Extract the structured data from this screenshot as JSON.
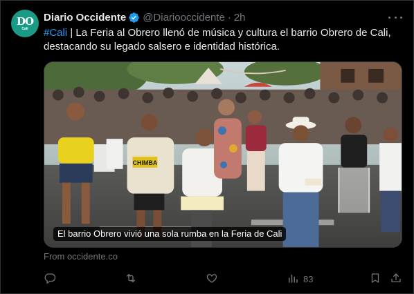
{
  "account": {
    "avatar_monogram": "DO",
    "avatar_subtext": "Cali",
    "name": "Diario Occidente",
    "handle": "@Diariooccidente",
    "separator": "·",
    "time": "2h"
  },
  "tweet": {
    "hashtag": "#Cali",
    "text": " | La Feria al Obrero llenó de música y cultura el barrio Obrero de Cali, destacando su legado salsero e identidad histórica."
  },
  "media": {
    "caption": "El barrio Obrero vivió una sola rumba en la Feria de Cali",
    "shirt_text": "CHIMBA"
  },
  "source": "From occidente.co",
  "actions": {
    "views_count": "83"
  },
  "icons": {
    "verified": "verified-badge-icon",
    "more": "more-icon",
    "reply": "reply-icon",
    "retweet": "retweet-icon",
    "like": "like-icon",
    "views": "views-icon",
    "bookmark": "bookmark-icon",
    "share": "share-icon"
  },
  "colors": {
    "background": "#000000",
    "text": "#e7e9ea",
    "muted": "#71767b",
    "accent": "#1d9bf0",
    "avatar_bg": "#1b9a86",
    "border": "#2f3336"
  }
}
